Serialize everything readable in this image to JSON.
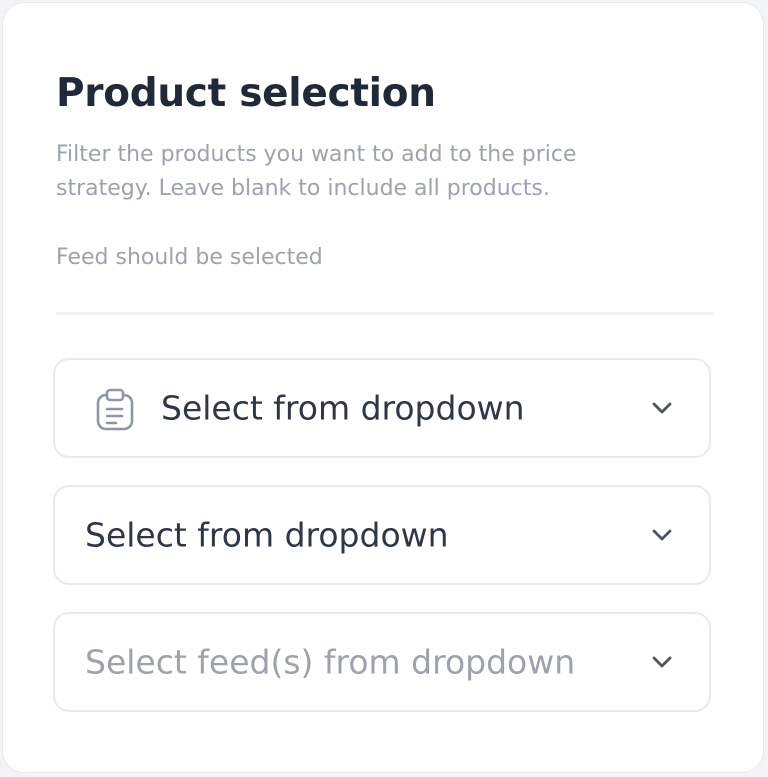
{
  "product_selection": {
    "title": "Product selection",
    "description": "Filter the products you want to add to the price strategy. Leave blank to include all products.",
    "hint": "Feed should be selected",
    "dropdowns": [
      {
        "label": "Select from dropdown",
        "icon": "clipboard-icon",
        "state": "value"
      },
      {
        "label": "Select from dropdown",
        "state": "value"
      },
      {
        "label": "Select feed(s) from dropdown",
        "state": "placeholder"
      }
    ]
  },
  "colors": {
    "title": "#1f2937",
    "muted_text": "#9ca3af",
    "select_text": "#2d3748",
    "border": "#e8eaee",
    "icon": "#8e97a8"
  }
}
